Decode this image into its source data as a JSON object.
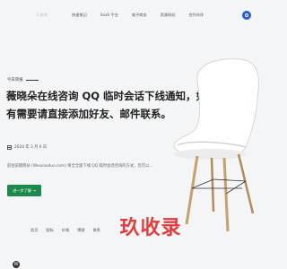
{
  "header": {
    "logo_text": "人训网",
    "nav": [
      "快速笔记",
      "SaaS 平台",
      "电子商务",
      "资源网站",
      "合作伙伴"
    ]
  },
  "hero": {
    "tag": "今日简报",
    "headline": "薇晓朵在线咨询 QQ 临时会话下线通知，如有需要请直接添加好友、邮件联系。",
    "date": "2024 年 3 月 6 日",
    "summary": "前往前期晓朵 (Weixiaoduo.com) 将全全面下线 QQ 临时会话咨询的方式，您可以…",
    "cta_label": "进一步了解 →"
  },
  "watermark": "玖收录",
  "footer": {
    "nav": [
      "首页",
      "图标",
      "价格",
      "博客",
      "联系"
    ]
  },
  "colors": {
    "accent": "#1a8a4d",
    "avatar": "#2a5bd7",
    "watermark": "#e63b3b",
    "background": "#f4f5f7"
  }
}
